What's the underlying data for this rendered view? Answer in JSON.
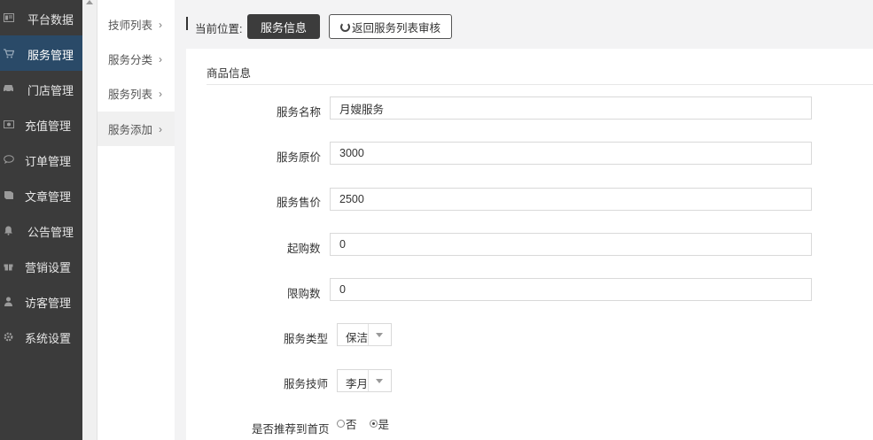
{
  "sidebar": {
    "items": [
      {
        "label": "平台数据",
        "icon": "dashboard-icon",
        "active": false
      },
      {
        "label": "服务管理",
        "icon": "cart-icon",
        "active": true
      },
      {
        "label": "门店管理",
        "icon": "car-icon",
        "active": false
      },
      {
        "label": "充值管理",
        "icon": "money-icon",
        "active": false
      },
      {
        "label": "订单管理",
        "icon": "comment-icon",
        "active": false
      },
      {
        "label": "文章管理",
        "icon": "book-icon",
        "active": false
      },
      {
        "label": "公告管理",
        "icon": "bell-icon",
        "active": false
      },
      {
        "label": "营销设置",
        "icon": "gift-icon",
        "active": false
      },
      {
        "label": "访客管理",
        "icon": "user-icon",
        "active": false
      },
      {
        "label": "系统设置",
        "icon": "gear-icon",
        "active": false
      }
    ]
  },
  "submenu": {
    "items": [
      {
        "label": "技师列表",
        "active": false
      },
      {
        "label": "服务分类",
        "active": false
      },
      {
        "label": "服务列表",
        "active": false
      },
      {
        "label": "服务添加",
        "active": true
      }
    ]
  },
  "topbar": {
    "breadcrumb_label": "当前位置:",
    "current_button": "服务信息",
    "back_button": "返回服务列表审核"
  },
  "form": {
    "section_title": "商品信息",
    "name": {
      "label": "服务名称",
      "value": "月嫂服务"
    },
    "original_price": {
      "label": "服务原价",
      "value": "3000"
    },
    "sale_price": {
      "label": "服务售价",
      "value": "2500"
    },
    "min_purchase": {
      "label": "起购数",
      "value": "0"
    },
    "max_purchase": {
      "label": "限购数",
      "value": "0"
    },
    "service_type": {
      "label": "服务类型",
      "value": "保洁"
    },
    "technician": {
      "label": "服务技师",
      "value": "李月"
    },
    "recommend": {
      "label": "是否推荐到首页",
      "options": [
        "否",
        "是"
      ],
      "selected": "是"
    }
  },
  "colors": {
    "sidebar_bg": "#3b3b3b",
    "sidebar_active": "#2a4a68",
    "dark_button": "#3c3c3c"
  }
}
